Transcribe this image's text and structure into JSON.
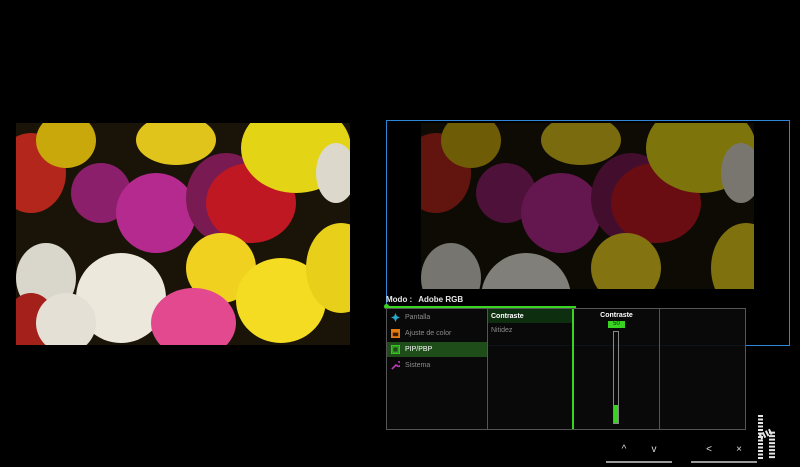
{
  "osd": {
    "mode_label": "Modo :",
    "mode_value": "Adobe RGB",
    "menu": [
      {
        "label": "Pantalla",
        "icon": "display-icon",
        "selected": false
      },
      {
        "label": "Ajuste de color",
        "icon": "color-adjust-icon",
        "selected": false
      },
      {
        "label": "PIP/PBP",
        "icon": "pip-icon",
        "selected": true
      },
      {
        "label": "Sistema",
        "icon": "wrench-icon",
        "selected": false
      }
    ],
    "submenu": [
      {
        "label": "Contraste",
        "selected": true
      },
      {
        "label": "Nitidez",
        "selected": false
      }
    ],
    "setting": {
      "title": "Contraste",
      "value": "50",
      "level": 0.2
    }
  },
  "nav_keys": [
    {
      "glyph": "^",
      "name": "up-key"
    },
    {
      "glyph": "v",
      "name": "down-key"
    },
    {
      "glyph": "<",
      "name": "back-key"
    },
    {
      "glyph": "×",
      "name": "exit-key"
    }
  ],
  "colors": {
    "accent": "#39d321",
    "frame": "#2f86d8"
  }
}
